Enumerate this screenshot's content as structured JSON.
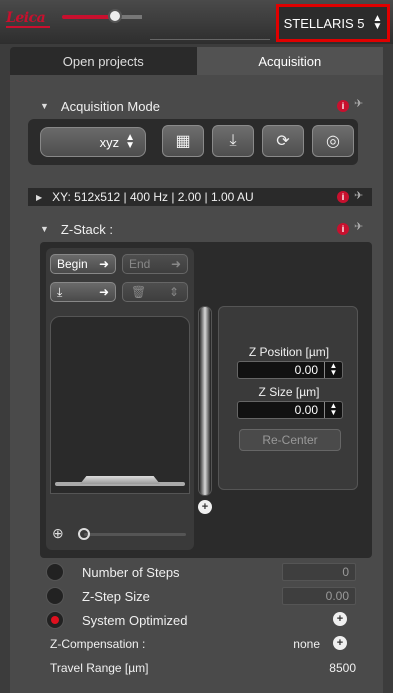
{
  "header": {
    "logo_text": "Leica",
    "microscope": "STELLARIS 5"
  },
  "tabs": [
    {
      "label": "Open projects",
      "active": false
    },
    {
      "label": "Acquisition",
      "active": true
    }
  ],
  "acquisition_mode": {
    "title": "Acquisition Mode",
    "mode_value": "xyz",
    "buttons": [
      "grid-icon",
      "download-icon",
      "refresh-target-icon",
      "target-check-icon"
    ]
  },
  "xy": {
    "summary": "XY: 512x512 | 400 Hz | 2.00 | 1.00 AU"
  },
  "zstack": {
    "title": "Z-Stack :",
    "begin_label": "Begin",
    "end_label": "End",
    "z_position_label": "Z Position [µm]",
    "z_position_value": "0.00",
    "z_size_label": "Z Size [µm]",
    "z_size_value": "0.00",
    "recenter_label": "Re-Center"
  },
  "options": {
    "number_of_steps_label": "Number of Steps",
    "number_of_steps_value": "0",
    "z_step_size_label": "Z-Step Size",
    "z_step_size_value": "0.00",
    "system_optimized_label": "System Optimized",
    "z_compensation_label": "Z-Compensation :",
    "z_compensation_value": "none",
    "travel_range_label": "Travel Range [µm]",
    "travel_range_value": "8500"
  },
  "colors": {
    "accent_red": "#c8102e",
    "highlight_red": "#e00000"
  }
}
